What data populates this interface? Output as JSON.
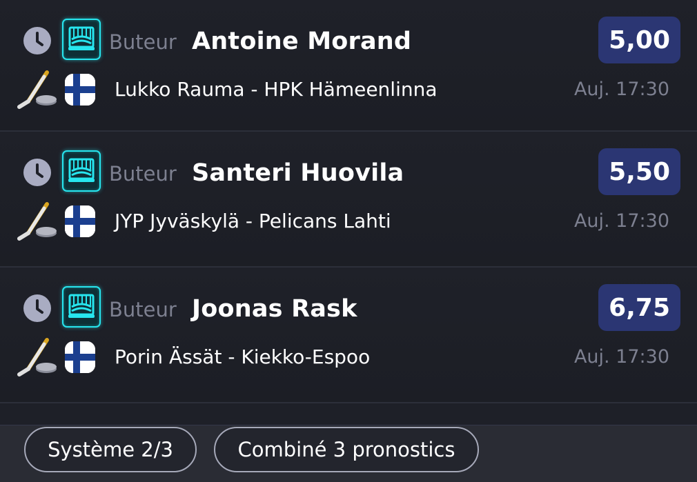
{
  "bets": [
    {
      "type": "Buteur",
      "player": "Antoine Morand",
      "odds": "5,00",
      "match": "Lukko Rauma - HPK Hämeenlinna",
      "time": "Auj. 17:30",
      "sport_icon": "ice-hockey-icon",
      "flag_icon": "finland-flag-icon",
      "status_icon": "clock-icon",
      "market_icon": "hockey-goal-icon"
    },
    {
      "type": "Buteur",
      "player": "Santeri Huovila",
      "odds": "5,50",
      "match": "JYP Jyväskylä - Pelicans Lahti",
      "time": "Auj. 17:30",
      "sport_icon": "ice-hockey-icon",
      "flag_icon": "finland-flag-icon",
      "status_icon": "clock-icon",
      "market_icon": "hockey-goal-icon"
    },
    {
      "type": "Buteur",
      "player": "Joonas Rask",
      "odds": "6,75",
      "match": "Porin Ässät - Kiekko-Espoo",
      "time": "Auj. 17:30",
      "sport_icon": "ice-hockey-icon",
      "flag_icon": "finland-flag-icon",
      "status_icon": "clock-icon",
      "market_icon": "hockey-goal-icon"
    }
  ],
  "bottom_bar": {
    "system_label": "Système 2/3",
    "combo_label": "Combiné 3 pronostics"
  },
  "colors": {
    "background": "#1e2028",
    "odds_badge": "#2b3673",
    "goal_badge_accent": "#27e6ef",
    "muted_text": "#7d8090",
    "clock_icon": "#a9acc2"
  }
}
